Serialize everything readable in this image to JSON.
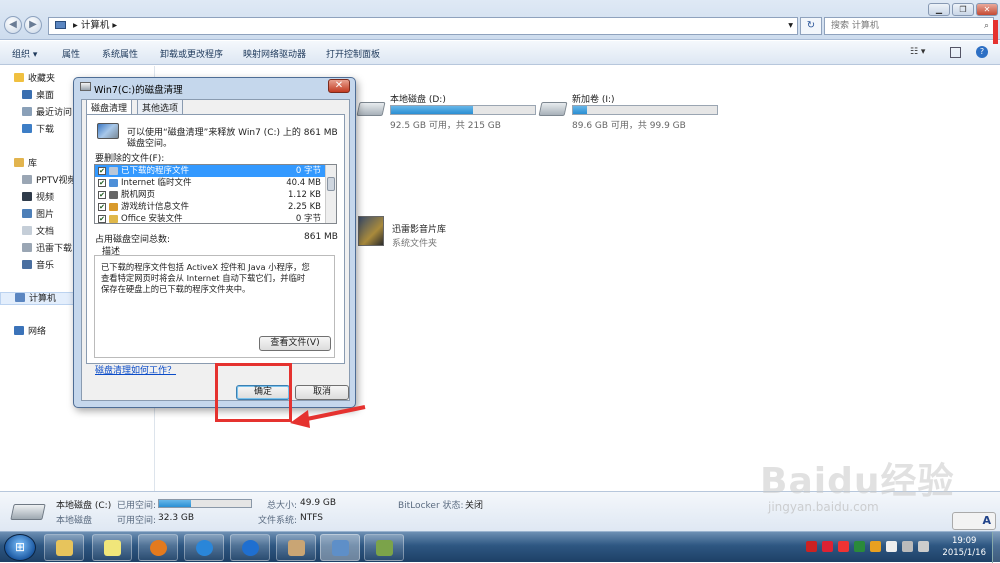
{
  "window": {
    "address": "计算机",
    "search_placeholder": "搜索 计算机"
  },
  "toolbar": {
    "organize": "组织 ▾",
    "properties": "属性",
    "system_properties": "系统属性",
    "uninstall": "卸载或更改程序",
    "map_drive": "映射网络驱动器",
    "control_panel": "打开控制面板"
  },
  "nav": {
    "favorites": "收藏夹",
    "desktop": "桌面",
    "recent": "最近访问",
    "downloads": "下载",
    "libraries": "库",
    "pptv": "PPTV视频",
    "videos": "视频",
    "pictures": "图片",
    "documents": "文档",
    "xunlei": "迅雷下载",
    "music": "音乐",
    "computer": "计算机",
    "network": "网络"
  },
  "drives": [
    {
      "name": "本地磁盘 (D:)",
      "size": "92.5 GB 可用，共 215 GB",
      "used_fraction": 0.57
    },
    {
      "name": "新加卷 (I:)",
      "size": "89.6 GB 可用，共 99.9 GB",
      "used_fraction": 0.1
    }
  ],
  "library": {
    "name": "迅雷影音片库",
    "type": "系统文件夹"
  },
  "details": {
    "drive_name": "本地磁盘 (C:)",
    "drive_type": "本地磁盘",
    "used_label": "已用空间:",
    "free_label": "可用空间:",
    "free_value": "32.3 GB",
    "total_label": "总大小:",
    "total_value": "49.9 GB",
    "fs_label": "文件系统:",
    "fs_value": "NTFS",
    "bitlocker_label": "BitLocker 状态:",
    "bitlocker_value": "关闭",
    "used_fraction": 0.35
  },
  "dialog": {
    "title": "Win7(C:)的磁盘清理",
    "tab_cleanup": "磁盘清理",
    "tab_other": "其他选项",
    "intro_line1": "可以使用“磁盘清理”来释放 Win7 (C:) 上的 861 MB",
    "intro_line2": "磁盘空间。",
    "files_label": "要删除的文件(F):",
    "files": [
      {
        "name": "已下载的程序文件",
        "size": "0 字节",
        "checked": "✔",
        "color": "#b9c7d8"
      },
      {
        "name": "Internet 临时文件",
        "size": "40.4 MB",
        "checked": "✔",
        "color": "#4d8fd8"
      },
      {
        "name": "脱机网页",
        "size": "1.12 KB",
        "checked": "✔",
        "color": "#666666"
      },
      {
        "name": "游戏统计信息文件",
        "size": "2.25 KB",
        "checked": "✔",
        "color": "#d99a2b"
      },
      {
        "name": "Office 安装文件",
        "size": "0 字节",
        "checked": "✔",
        "color": "#e0b84a"
      }
    ],
    "total_label": "占用磁盘空间总数:",
    "total_value": "861 MB",
    "desc_label": "描述",
    "desc_line1": "已下载的程序文件包括 ActiveX 控件和 Java 小程序，您",
    "desc_line2": "查看特定网页时将会从 Internet 自动下载它们，并临时",
    "desc_line3": "保存在硬盘上的已下载的程序文件夹中。",
    "view_files": "查看文件(V)",
    "help_link": "磁盘清理如何工作？",
    "ok": "确定",
    "cancel": "取消"
  },
  "taskbar": {
    "time": "19:09",
    "date": "2015/1/16",
    "lang": "A"
  },
  "watermark": {
    "main": "Baidu经验",
    "sub": "jingyan.baidu.com"
  }
}
